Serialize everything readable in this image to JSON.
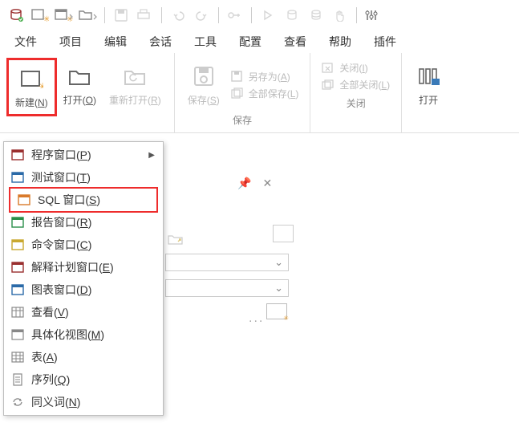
{
  "menubar": {
    "items": [
      "文件",
      "项目",
      "编辑",
      "会话",
      "工具",
      "配置",
      "查看",
      "帮助",
      "插件"
    ]
  },
  "ribbon": {
    "new": "新建(N)",
    "open": "打开(O)",
    "reopen": "重新打开(R)",
    "save": "保存(S)",
    "saveas": "另存为(A)",
    "saveall": "全部保存(L)",
    "close": "关闭(I)",
    "closeall": "全部关闭(L)",
    "open2": "打开",
    "group_save": "保存",
    "group_close": "关闭"
  },
  "dropdown": {
    "items": [
      {
        "label": "程序窗口(P)",
        "has_submenu": true,
        "color": "#9a2f2f"
      },
      {
        "label": "测试窗口(T)",
        "has_submenu": false,
        "color": "#2a6aa8"
      },
      {
        "label": "SQL 窗口(S)",
        "has_submenu": false,
        "color": "#d97a2b",
        "highlighted": true
      },
      {
        "label": "报告窗口(R)",
        "has_submenu": false,
        "color": "#2a8f4a"
      },
      {
        "label": "命令窗口(C)",
        "has_submenu": false,
        "color": "#c9a82f"
      },
      {
        "label": "解释计划窗口(E)",
        "has_submenu": false,
        "color": "#9a2f2f"
      },
      {
        "label": "图表窗口(D)",
        "has_submenu": false,
        "color": "#2a6aa8"
      },
      {
        "label": "查看(V)",
        "has_submenu": false,
        "icon": "table"
      },
      {
        "label": "具体化视图(M)",
        "has_submenu": false,
        "icon": "window"
      },
      {
        "label": "表(A)",
        "has_submenu": false,
        "icon": "grid"
      },
      {
        "label": "序列(Q)",
        "has_submenu": false,
        "icon": "doc"
      },
      {
        "label": "同义词(N)",
        "has_submenu": false,
        "icon": "sync"
      }
    ]
  }
}
